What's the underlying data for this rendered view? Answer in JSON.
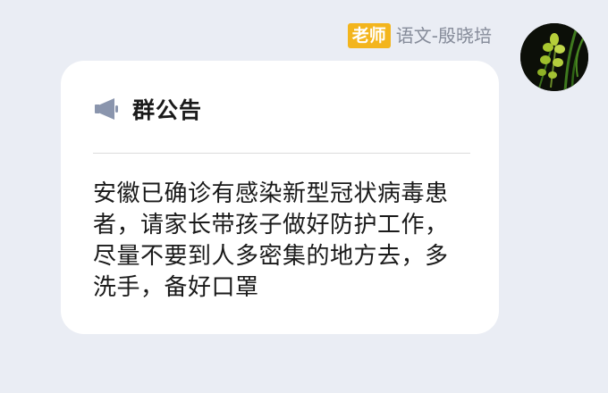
{
  "sender": {
    "role_badge": "老师",
    "name": "语文-殷晓培"
  },
  "avatar": {
    "icon": "avatar-orchid-photo"
  },
  "notice": {
    "icon": "megaphone-icon",
    "title": "群公告",
    "body": "安徽已确诊有感染新型冠状病毒患者，请家长带孩子做好防护工作，尽量不要到人多密集的地方去，多洗手，备好口罩"
  },
  "colors": {
    "background": "#eaedf4",
    "badge": "#f3b51d",
    "icon": "#8a95ad"
  }
}
